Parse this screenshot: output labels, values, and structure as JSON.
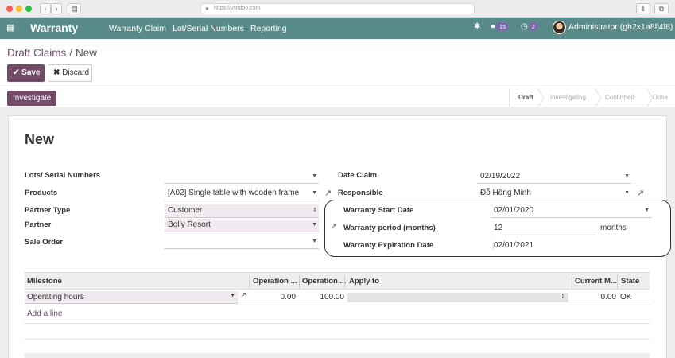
{
  "browser": {
    "url": "https://viindoo.com",
    "back_icon": "chevron-left-icon",
    "forward_icon": "chevron-right-icon",
    "sidebar_icon": "sidebar-icon",
    "download_icon": "download-icon",
    "window_icon": "window-icon"
  },
  "navbar": {
    "apps_icon": "apps-grid-icon",
    "brand": "Warranty",
    "menu": [
      "Warranty Claim",
      "Lot/Serial Numbers",
      "Reporting"
    ],
    "activity_icon": "bug-icon",
    "messages_count": "15",
    "activities_count": "2",
    "user": "Administrator (gh2x1a8fj4l8)",
    "color": "#5a8b8b"
  },
  "control_panel": {
    "breadcrumb_parent": "Draft Claims",
    "breadcrumb_sep": "/",
    "breadcrumb_current": "New",
    "save_label": "Save",
    "discard_label": "Discard",
    "primary_color": "#714b67"
  },
  "statusbar": {
    "action_label": "Investigate",
    "stages": [
      "Draft",
      "Investigating",
      "Confirmed",
      "Done"
    ],
    "active_stage": "Draft"
  },
  "form": {
    "title": "New",
    "left": {
      "lots_label": "Lots/ Serial Numbers",
      "lots_value": "",
      "products_label": "Products",
      "products_value": "[A02] Single table with wooden frame",
      "partner_type_label": "Partner Type",
      "partner_type_value": "Customer",
      "partner_label": "Partner",
      "partner_value": "Bolly Resort",
      "sale_order_label": "Sale Order",
      "sale_order_value": ""
    },
    "right": {
      "date_claim_label": "Date Claim",
      "date_claim_value": "02/19/2022",
      "responsible_label": "Responsible",
      "responsible_value": "Đỗ Hồng Minh",
      "warranty_start_label": "Warranty Start Date",
      "warranty_start_value": "02/01/2020",
      "warranty_period_label": "Warranty period (months)",
      "warranty_period_value": "12",
      "warranty_period_unit": "months",
      "warranty_expiration_label": "Warranty Expiration Date",
      "warranty_expiration_value": "02/01/2021"
    }
  },
  "milestone_table": {
    "headers": [
      "Milestone",
      "Operation ...",
      "Operation ...",
      "Apply to",
      "Current M...",
      "State"
    ],
    "rows": [
      {
        "milestone": "Operating hours",
        "op1": "0.00",
        "op2": "100.00",
        "apply_to": "",
        "current": "0.00",
        "state": "OK"
      }
    ],
    "add_line": "Add a line"
  }
}
